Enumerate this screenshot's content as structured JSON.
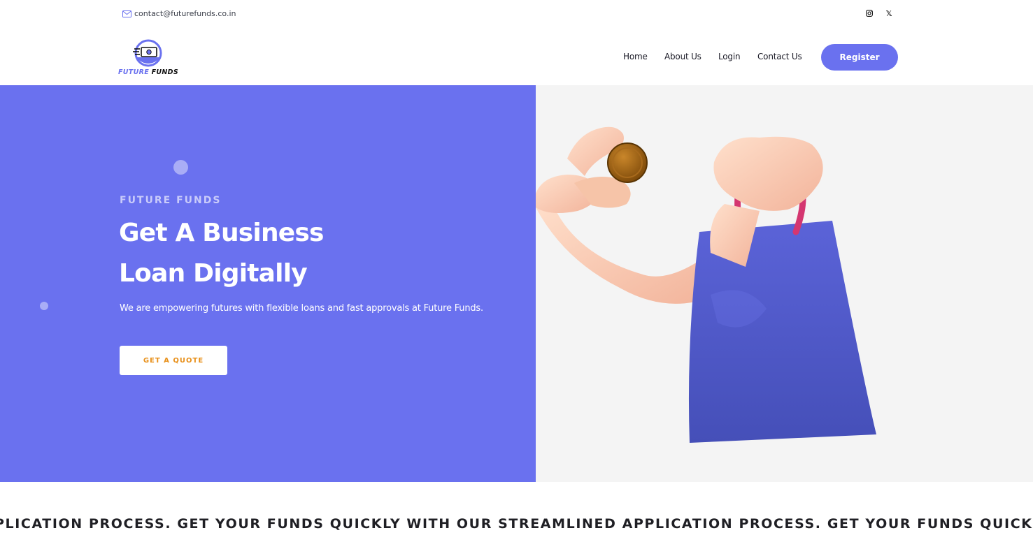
{
  "topbar": {
    "email": "contact@futurefunds.co.in",
    "email_icon": "mail-icon",
    "social": [
      "instagram-icon",
      "x-icon"
    ],
    "x_glyph": "𝕏"
  },
  "nav": {
    "logo": {
      "word1": "FUTURE",
      "word2": "FUNDS"
    },
    "links": [
      "Home",
      "About Us",
      "Login",
      "Contact Us"
    ],
    "register": "Register"
  },
  "hero": {
    "eyebrow": "FUTURE FUNDS",
    "headline_line1": "Get A Business",
    "headline_line2": "Loan Digitally",
    "subtext": "We are empowering futures with flexible loans and fast approvals at Future Funds.",
    "cta": "GET A QUOTE"
  },
  "marquee": {
    "text": "PLICATION PROCESS. GET YOUR FUNDS QUICKLY WITH OUR STREAMLINED APPLICATION PROCESS. GET YOUR FUNDS QUICKLY WI"
  },
  "colors": {
    "accent": "#6a71ef",
    "cta_text": "#e8901a",
    "hero_right_bg": "#f4f4f4"
  }
}
